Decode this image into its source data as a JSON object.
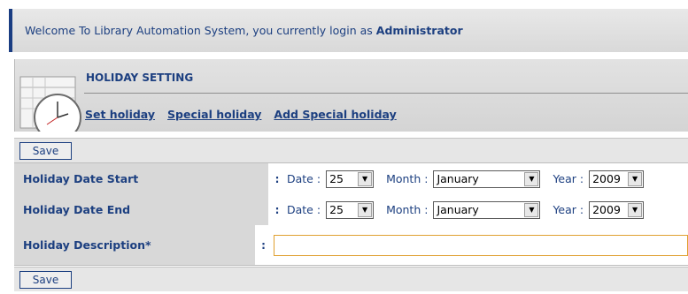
{
  "header": {
    "welcome_text": "Welcome To Library Automation System, you currently login as",
    "user": "Administrator"
  },
  "panel": {
    "title": "HOLIDAY SETTING",
    "links": [
      "Set holiday",
      "Special holiday",
      "Add Special holiday"
    ]
  },
  "buttons": {
    "save_label": "Save"
  },
  "form": {
    "colon": ":",
    "date_label": "Date :",
    "month_label": "Month :",
    "year_label": "Year :",
    "rows": [
      {
        "label": "Holiday Date Start",
        "day": "25",
        "month": "January",
        "year": "2009"
      },
      {
        "label": "Holiday Date End",
        "day": "25",
        "month": "January",
        "year": "2009"
      }
    ],
    "description_label": "Holiday Description*",
    "description_value": ""
  },
  "colors": {
    "primary": "#1c3f80",
    "input_focus": "#e0a030"
  },
  "icons": {
    "panel_icon": "calendar-clock-icon",
    "dropdown": "chevron-down-icon"
  }
}
